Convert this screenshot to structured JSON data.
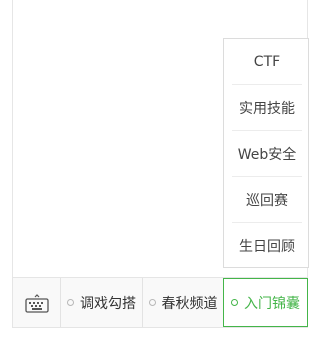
{
  "popup_menu": {
    "items": [
      {
        "label": "CTF"
      },
      {
        "label": "实用技能"
      },
      {
        "label": "Web安全"
      },
      {
        "label": "巡回赛"
      },
      {
        "label": "生日回顾"
      }
    ]
  },
  "bottom_bar": {
    "keyboard_icon": "keyboard-icon",
    "menus": [
      {
        "label": "调戏勾搭"
      },
      {
        "label": "春秋频道"
      },
      {
        "label": "入门锦囊"
      }
    ],
    "active_color": "#44b549"
  }
}
